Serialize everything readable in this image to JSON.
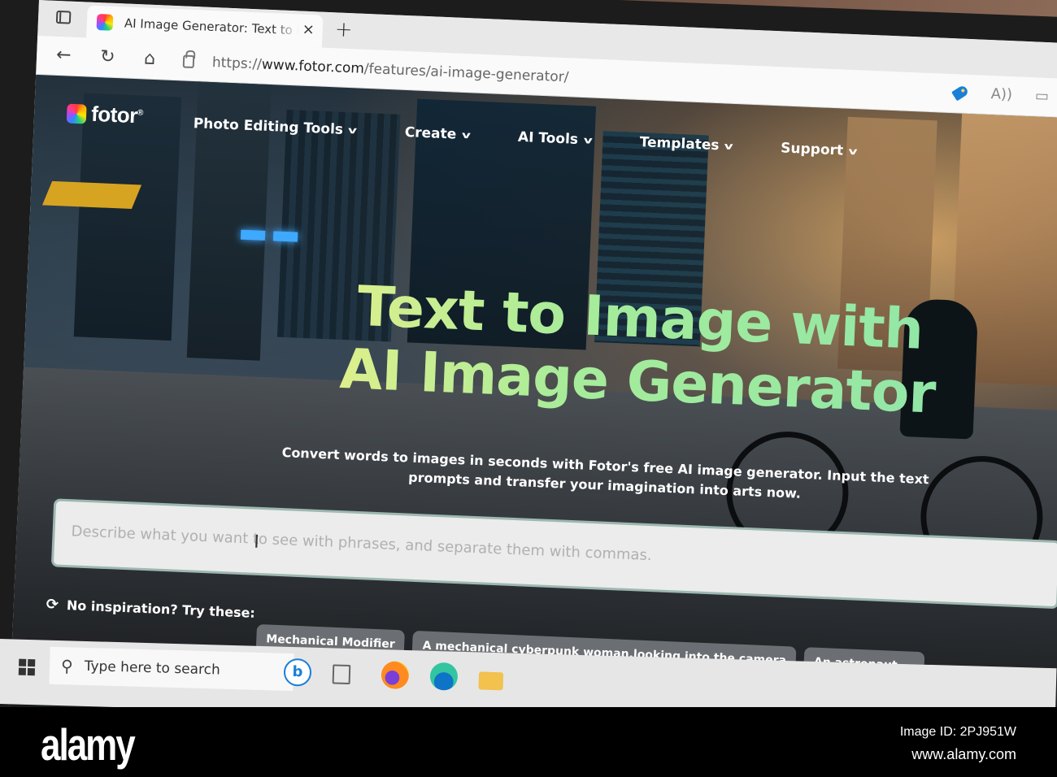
{
  "browser": {
    "tab": {
      "title": "AI Image Generator: Text to Image",
      "close_label": "×"
    },
    "new_tab_label": "+",
    "nav": {
      "back": "←",
      "refresh": "↻",
      "home": "⌂"
    },
    "url": {
      "scheme": "https://",
      "host": "www.fotor.com",
      "path": "/features/ai-image-generator/"
    },
    "toolbar_icons": [
      "tag-icon",
      "read-aloud-icon",
      "immersive-reader-icon",
      "favorite-star-icon"
    ],
    "read_aloud_glyph": "A))",
    "reader_glyph": "▭",
    "star_glyph": "☆"
  },
  "site": {
    "logo_text": "fotor",
    "logo_reg": "®",
    "nav": [
      {
        "label": "Photo Editing Tools",
        "chevron": "v"
      },
      {
        "label": "Create",
        "chevron": "v"
      },
      {
        "label": "AI Tools",
        "chevron": "v"
      },
      {
        "label": "Templates",
        "chevron": "v"
      },
      {
        "label": "Support",
        "chevron": "v"
      }
    ],
    "headline_line1": "Text to Image with",
    "headline_line2": "AI Image Generator",
    "subtitle": "Convert words to images in seconds with Fotor's free AI image generator. Input the text prompts and transfer your imagination into arts now.",
    "prompt": {
      "value": "",
      "placeholder": "Describe what you want to see with phrases, and separate them with commas.",
      "cursor_glyph": "I"
    },
    "inspiration": {
      "refresh_glyph": "⟳",
      "label": "No inspiration? Try these:",
      "chips": [
        "Mechanical Modifier",
        "A mechanical cyberpunk woman,looking into the camera",
        "An astronaut ..."
      ]
    },
    "colors": {
      "headline_green": "#a6ec9a",
      "prompt_border": "#9db8b0",
      "chip_bg": "#6b6e72"
    }
  },
  "taskbar": {
    "search_placeholder": "Type here to search",
    "search_glyph": "⚲",
    "bing_glyph": "b",
    "apps": [
      "windows-start-icon",
      "bing-chat-icon",
      "task-view-icon",
      "firefox-icon",
      "edge-icon",
      "file-explorer-icon"
    ]
  },
  "watermark": {
    "logo": "alamy",
    "image_id": "Image ID: 2PJ951W",
    "site": "www.alamy.com"
  }
}
